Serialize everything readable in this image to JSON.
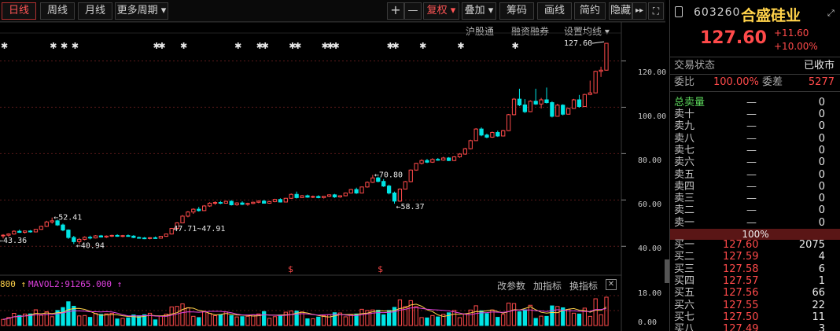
{
  "toolbar": {
    "tabs": [
      "日线",
      "周线",
      "月线",
      "更多周期 ▾"
    ],
    "plus": "+",
    "minus": "—",
    "fuquan": "复权 ▾",
    "diejia": "叠加 ▾",
    "chouma": "筹码",
    "huaxian": "画线",
    "jianyue": "简约",
    "yincang": "隐藏",
    "forward": "▸▸",
    "expand": "⛶"
  },
  "subtabs": [
    "沪股通",
    "融资融券",
    "设置均线 ▾"
  ],
  "price_axis": [
    "120.00",
    "100.00",
    "80.00",
    "60.00",
    "40.00"
  ],
  "volume_axis": [
    "18.00",
    "0.00"
  ],
  "annotations": {
    "last": "127.60",
    "high1": "52.41",
    "low1": "43.36",
    "low2": "40.94",
    "range": "47.71~47.91",
    "high2": "70.80",
    "low3": "58.37",
    "s_marks": [
      "$",
      "$"
    ]
  },
  "volume_panel": {
    "label1": "800 ↑",
    "label2": "MAVOL2:91265.000 ↑",
    "tabs": [
      "改参数",
      "加指标",
      "换指标"
    ],
    "close": "✕"
  },
  "stock": {
    "code": "603260",
    "name": "合盛硅业",
    "price": "127.60",
    "change": "+11.60",
    "change_pct": "+10.00%",
    "status_label": "交易状态",
    "status_value": "已收市",
    "weibi_label": "委比",
    "weibi_value": "100.00%",
    "weicha_label": "委差",
    "weicha_value": "5277"
  },
  "sell_book": {
    "total_label": "总卖量",
    "total_dash": "—",
    "total_qty": "0",
    "levels": [
      {
        "label": "卖十",
        "dash": "—",
        "qty": "0"
      },
      {
        "label": "卖九",
        "dash": "—",
        "qty": "0"
      },
      {
        "label": "卖八",
        "dash": "—",
        "qty": "0"
      },
      {
        "label": "卖七",
        "dash": "—",
        "qty": "0"
      },
      {
        "label": "卖六",
        "dash": "—",
        "qty": "0"
      },
      {
        "label": "卖五",
        "dash": "—",
        "qty": "0"
      },
      {
        "label": "卖四",
        "dash": "—",
        "qty": "0"
      },
      {
        "label": "卖三",
        "dash": "—",
        "qty": "0"
      },
      {
        "label": "卖二",
        "dash": "—",
        "qty": "0"
      },
      {
        "label": "卖一",
        "dash": "—",
        "qty": "0"
      }
    ]
  },
  "ratio": "100%",
  "buy_book": [
    {
      "label": "买一",
      "price": "127.60",
      "qty": "2075"
    },
    {
      "label": "买二",
      "price": "127.59",
      "qty": "4"
    },
    {
      "label": "买三",
      "price": "127.58",
      "qty": "6"
    },
    {
      "label": "买四",
      "price": "127.57",
      "qty": "1"
    },
    {
      "label": "买五",
      "price": "127.56",
      "qty": "66"
    },
    {
      "label": "买六",
      "price": "127.55",
      "qty": "22"
    },
    {
      "label": "买七",
      "price": "127.50",
      "qty": "11"
    },
    {
      "label": "买八",
      "price": "127.49",
      "qty": "3"
    }
  ],
  "colors": {
    "up": "#ff4a4a",
    "down": "#00e5e5",
    "accent": "#ffd24a"
  },
  "candles": [
    [
      44.5,
      45.2,
      43.4,
      44.8
    ],
    [
      44.8,
      45.6,
      44.2,
      45.3
    ],
    [
      45.3,
      46.9,
      45.0,
      46.5
    ],
    [
      46.5,
      47.2,
      45.8,
      46.0
    ],
    [
      46.0,
      46.8,
      45.5,
      46.6
    ],
    [
      46.6,
      47.0,
      45.9,
      46.2
    ],
    [
      46.2,
      47.5,
      46.0,
      47.3
    ],
    [
      47.3,
      48.9,
      47.1,
      48.6
    ],
    [
      48.6,
      51.0,
      48.3,
      50.5
    ],
    [
      50.5,
      52.4,
      49.8,
      51.0
    ],
    [
      51.0,
      51.5,
      48.8,
      49.2
    ],
    [
      49.2,
      49.8,
      46.5,
      47.0
    ],
    [
      47.0,
      47.3,
      43.2,
      43.8
    ],
    [
      43.8,
      44.5,
      41.0,
      42.0
    ],
    [
      42.0,
      43.6,
      40.9,
      43.0
    ],
    [
      43.0,
      44.3,
      42.6,
      43.9
    ],
    [
      43.9,
      44.6,
      43.0,
      43.6
    ],
    [
      43.6,
      44.8,
      43.4,
      44.5
    ],
    [
      44.5,
      44.9,
      43.8,
      44.0
    ],
    [
      44.0,
      44.7,
      43.6,
      44.4
    ],
    [
      44.4,
      45.0,
      44.0,
      44.7
    ],
    [
      44.7,
      45.2,
      44.1,
      44.3
    ],
    [
      44.3,
      44.9,
      43.9,
      44.6
    ],
    [
      44.6,
      45.1,
      44.2,
      44.4
    ],
    [
      44.4,
      44.8,
      43.5,
      43.8
    ],
    [
      43.8,
      44.2,
      43.4,
      43.6
    ],
    [
      43.6,
      44.0,
      43.1,
      43.4
    ],
    [
      43.4,
      43.9,
      43.0,
      43.7
    ],
    [
      43.7,
      44.2,
      43.3,
      43.5
    ],
    [
      43.5,
      44.5,
      43.4,
      44.3
    ],
    [
      44.3,
      45.5,
      44.1,
      45.3
    ],
    [
      45.3,
      47.9,
      45.1,
      47.7
    ],
    [
      47.7,
      50.4,
      47.5,
      50.1
    ],
    [
      50.1,
      53.5,
      49.9,
      53.0
    ],
    [
      53.0,
      55.2,
      52.5,
      54.8
    ],
    [
      54.8,
      56.4,
      54.0,
      56.0
    ],
    [
      56.0,
      57.0,
      55.0,
      55.4
    ],
    [
      55.4,
      57.8,
      55.2,
      57.4
    ],
    [
      57.4,
      59.0,
      57.0,
      58.6
    ],
    [
      58.6,
      59.4,
      57.9,
      58.9
    ],
    [
      58.9,
      59.5,
      58.2,
      58.6
    ],
    [
      58.6,
      59.7,
      58.4,
      59.4
    ],
    [
      59.4,
      59.9,
      57.6,
      57.9
    ],
    [
      57.9,
      59.0,
      57.5,
      58.7
    ],
    [
      58.7,
      59.4,
      57.8,
      58.1
    ],
    [
      58.1,
      58.8,
      57.5,
      58.5
    ],
    [
      58.5,
      59.3,
      58.2,
      59.0
    ],
    [
      59.0,
      59.8,
      58.6,
      59.5
    ],
    [
      59.5,
      60.0,
      58.4,
      58.6
    ],
    [
      58.6,
      59.6,
      58.4,
      59.3
    ],
    [
      59.3,
      60.5,
      59.0,
      60.2
    ],
    [
      60.2,
      60.7,
      58.9,
      59.1
    ],
    [
      59.1,
      60.9,
      59.0,
      60.7
    ],
    [
      60.7,
      62.8,
      60.5,
      62.4
    ],
    [
      62.4,
      63.6,
      60.6,
      61.0
    ],
    [
      61.0,
      62.1,
      60.8,
      61.8
    ],
    [
      61.8,
      62.3,
      60.9,
      61.2
    ],
    [
      61.2,
      61.9,
      60.8,
      61.5
    ],
    [
      61.5,
      62.0,
      60.7,
      61.0
    ],
    [
      61.0,
      61.8,
      60.6,
      61.6
    ],
    [
      61.6,
      62.4,
      61.3,
      62.2
    ],
    [
      62.2,
      62.6,
      60.9,
      61.3
    ],
    [
      61.3,
      62.0,
      61.0,
      61.8
    ],
    [
      61.8,
      63.2,
      61.6,
      63.0
    ],
    [
      63.0,
      64.8,
      62.8,
      64.5
    ],
    [
      64.5,
      65.3,
      62.6,
      63.0
    ],
    [
      63.0,
      65.8,
      62.9,
      65.6
    ],
    [
      65.6,
      68.0,
      65.3,
      67.6
    ],
    [
      67.6,
      70.8,
      67.3,
      69.5
    ],
    [
      69.5,
      70.1,
      67.6,
      68.0
    ],
    [
      68.0,
      69.0,
      65.6,
      66.0
    ],
    [
      66.0,
      66.6,
      62.4,
      63.0
    ],
    [
      63.0,
      63.6,
      58.4,
      59.5
    ],
    [
      59.5,
      65.0,
      59.2,
      64.7
    ],
    [
      64.7,
      68.2,
      64.5,
      67.9
    ],
    [
      67.9,
      73.2,
      67.6,
      72.9
    ],
    [
      72.9,
      76.0,
      72.6,
      75.8
    ],
    [
      75.8,
      77.6,
      75.3,
      77.0
    ],
    [
      77.0,
      77.7,
      75.9,
      76.3
    ],
    [
      76.3,
      78.0,
      76.0,
      77.5
    ],
    [
      77.5,
      78.1,
      76.9,
      77.2
    ],
    [
      77.2,
      78.6,
      76.9,
      78.1
    ],
    [
      78.1,
      78.5,
      76.8,
      77.0
    ],
    [
      77.0,
      78.9,
      76.8,
      78.6
    ],
    [
      78.6,
      80.2,
      78.2,
      79.8
    ],
    [
      79.8,
      82.5,
      79.5,
      82.1
    ],
    [
      82.1,
      86.0,
      81.8,
      85.6
    ],
    [
      85.6,
      91.0,
      85.4,
      90.6
    ],
    [
      90.6,
      91.3,
      87.5,
      88.0
    ],
    [
      88.0,
      88.6,
      86.6,
      87.1
    ],
    [
      87.1,
      89.5,
      86.8,
      89.1
    ],
    [
      89.1,
      89.9,
      87.2,
      87.6
    ],
    [
      87.6,
      90.3,
      87.4,
      89.9
    ],
    [
      89.9,
      97.1,
      89.7,
      96.8
    ],
    [
      96.8,
      104.0,
      96.5,
      103.5
    ],
    [
      103.5,
      108.0,
      100.5,
      101.0
    ],
    [
      101.0,
      103.5,
      97.5,
      98.1
    ],
    [
      98.1,
      103.0,
      97.9,
      102.6
    ],
    [
      102.6,
      108.0,
      101.0,
      101.4
    ],
    [
      101.4,
      104.0,
      99.5,
      103.2
    ],
    [
      103.2,
      108.5,
      101.6,
      102.0
    ],
    [
      102.0,
      102.6,
      95.6,
      96.1
    ],
    [
      96.1,
      101.5,
      95.9,
      100.9
    ],
    [
      100.9,
      101.3,
      96.5,
      97.0
    ],
    [
      97.0,
      99.8,
      96.9,
      99.5
    ],
    [
      99.5,
      103.6,
      99.3,
      103.2
    ],
    [
      103.2,
      105.3,
      99.8,
      100.3
    ],
    [
      100.3,
      105.8,
      100.1,
      105.5
    ],
    [
      105.5,
      111.5,
      105.2,
      106.2
    ],
    [
      106.2,
      115.8,
      106.0,
      115.5
    ],
    [
      115.5,
      117.5,
      113.1,
      116.0
    ],
    [
      116.0,
      127.6,
      115.8,
      127.6
    ]
  ]
}
